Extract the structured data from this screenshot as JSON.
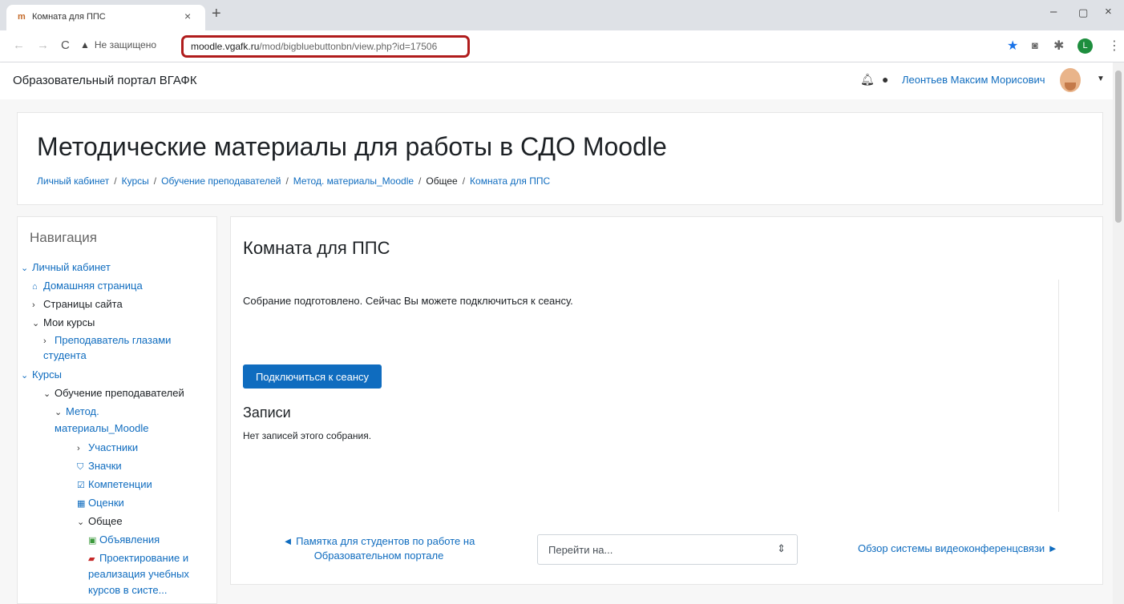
{
  "browser": {
    "tab_title": "Комната для ППС",
    "tab_favicon": "moodle-favicon",
    "address_warning": "Не защищено",
    "url_host": "moodle.vgafk.ru",
    "url_path": "/mod/bigbluebuttonbn/view.php?id=17506",
    "profile_initial": "L"
  },
  "navbar": {
    "site_name": "Образовательный портал ВГАФК",
    "user_name": "Леонтьев Максим Морисович"
  },
  "header": {
    "course_title": "Методические материалы для работы в СДО Moodle",
    "breadcrumb": [
      "Личный кабинет",
      "Курсы",
      "Обучение преподавателей",
      "Метод. материалы_Moodle",
      "Общее",
      "Комната для ППС"
    ],
    "separator": "/"
  },
  "sidebar": {
    "title": "Навигация",
    "items": [
      {
        "label": "Личный кабинет",
        "icon": "chevron-down-icon"
      },
      {
        "label": "Домашняя страница",
        "icon": "home-icon"
      },
      {
        "label": "Страницы сайта",
        "icon": "chevron-right-icon"
      },
      {
        "label": "Мои курсы",
        "icon": "chevron-down-icon"
      },
      {
        "label": "Преподаватель глазами",
        "icon": "chevron-right-icon"
      },
      {
        "label": "студента"
      },
      {
        "label": "Курсы",
        "icon": "chevron-down-icon"
      },
      {
        "label": "Обучение преподавателей",
        "icon": "chevron-down-icon"
      },
      {
        "label": "Метод.",
        "icon": "chevron-down-icon"
      },
      {
        "label": "материалы_Moodle"
      },
      {
        "label": "Участники",
        "icon": "chevron-right-icon"
      },
      {
        "label": "Значки",
        "icon": "shield-icon"
      },
      {
        "label": "Компетенции",
        "icon": "checkbox-icon"
      },
      {
        "label": "Оценки",
        "icon": "table-icon"
      },
      {
        "label": "Общее",
        "icon": "chevron-down-icon"
      },
      {
        "label": "Объявления",
        "icon": "forum-icon"
      },
      {
        "label": "Проектирование и",
        "icon": "pdf-icon"
      },
      {
        "label": "реализация учебных"
      },
      {
        "label": "курсов в систе..."
      }
    ]
  },
  "main": {
    "room_title": "Комната для ППС",
    "status_text": "Собрание подготовлено. Сейчас Вы можете подключиться к сеансу.",
    "join_button": "Подключиться к сеансу",
    "recordings_title": "Записи",
    "recordings_empty": "Нет записей этого собрания.",
    "prev_link_line1": "◄ Памятка для студентов по работе на",
    "prev_link_line2": "Образовательном портале",
    "jump_placeholder": "Перейти на...",
    "next_link": "Обзор системы видеоконференцсвязи ►"
  }
}
